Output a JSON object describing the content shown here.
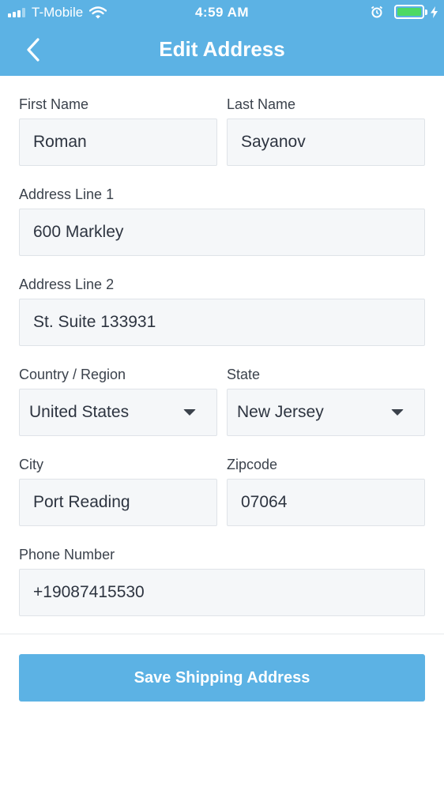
{
  "status_bar": {
    "carrier": "T-Mobile",
    "time": "4:59 AM",
    "icons": [
      "signal-icon",
      "wifi-icon",
      "alarm-icon",
      "battery-icon",
      "charging-icon"
    ],
    "battery_color": "#4cd964"
  },
  "header": {
    "title": "Edit Address",
    "back_icon": "chevron-left-icon",
    "background": "#5cb2e4"
  },
  "form": {
    "first_name": {
      "label": "First Name",
      "value": "Roman"
    },
    "last_name": {
      "label": "Last Name",
      "value": "Sayanov"
    },
    "address_line_1": {
      "label": "Address Line 1",
      "value": "600 Markley"
    },
    "address_line_2": {
      "label": "Address Line 2",
      "value": "St. Suite 133931"
    },
    "country": {
      "label": "Country / Region",
      "value": "United States"
    },
    "state": {
      "label": "State",
      "value": "New Jersey"
    },
    "city": {
      "label": "City",
      "value": "Port Reading"
    },
    "zipcode": {
      "label": "Zipcode",
      "value": "07064"
    },
    "phone": {
      "label": "Phone Number",
      "value": "+19087415530"
    }
  },
  "actions": {
    "save_label": "Save Shipping Address",
    "accent": "#5cb2e4"
  }
}
